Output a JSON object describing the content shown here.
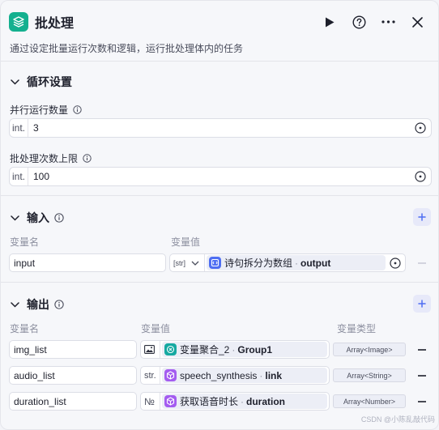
{
  "header": {
    "title": "批处理",
    "description": "通过设定批量运行次数和逻辑，运行批处理体内的任务"
  },
  "loop_settings": {
    "section_title": "循环设置",
    "parallel": {
      "label": "并行运行数量",
      "prefix": "int.",
      "value": "3"
    },
    "max_batch": {
      "label": "批处理次数上限",
      "prefix": "int.",
      "value": "100"
    }
  },
  "inputs": {
    "section_title": "输入",
    "col_name": "变量名",
    "col_value": "变量值",
    "rows": [
      {
        "name": "input",
        "type_prefix": "[str]",
        "node": "诗句拆分为数组",
        "var": "output",
        "node_color": "#4e6ef2"
      }
    ]
  },
  "outputs": {
    "section_title": "输出",
    "col_name": "变量名",
    "col_value": "变量值",
    "col_type": "变量类型",
    "rows": [
      {
        "name": "img_list",
        "type_prefix": "",
        "type_icon": "image-icon",
        "node": "变量聚合_2",
        "var": "Group1",
        "node_color": "#16a9a1",
        "var_type": "Array<Image>"
      },
      {
        "name": "audio_list",
        "type_prefix": "str.",
        "node": "speech_synthesis",
        "var": "link",
        "node_color": "#a45cf0",
        "var_type": "Array<String>"
      },
      {
        "name": "duration_list",
        "type_prefix": "№",
        "node": "获取语音时长",
        "var": "duration",
        "node_color": "#a45cf0",
        "var_type": "Array<Number>"
      }
    ]
  },
  "watermark": "CSDN @小陈乱敲代码",
  "colors": {
    "accent": "#4e6ef2",
    "logo": "#14b08f",
    "panel_bg": "#f6f7fa"
  }
}
